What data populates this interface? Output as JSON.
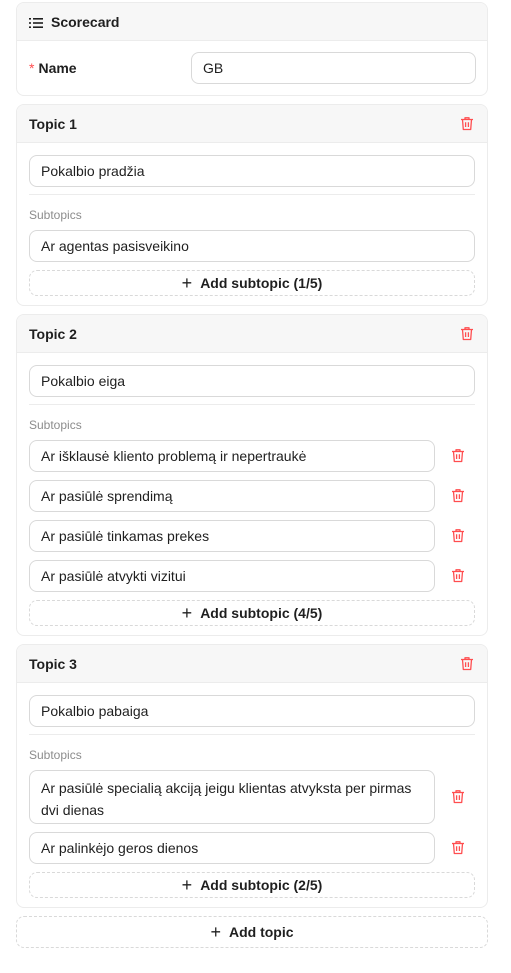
{
  "scorecard": {
    "title": "Scorecard",
    "name_label": "Name",
    "required_mark": "*",
    "name_value": "GB"
  },
  "subtopics_label": "Subtopics",
  "topics": [
    {
      "title": "Topic 1",
      "name": "Pokalbio pradžia",
      "subtopics": [
        "Ar agentas pasisveikino"
      ],
      "add_label": "Add subtopic (1/5)"
    },
    {
      "title": "Topic 2",
      "name": "Pokalbio eiga",
      "subtopics": [
        "Ar išklausė kliento problemą  ir nepertraukė",
        "Ar pasiūlė sprendimą",
        "Ar pasiūlė tinkamas prekes",
        "Ar pasiūlė atvykti vizitui"
      ],
      "add_label": "Add subtopic (4/5)"
    },
    {
      "title": "Topic 3",
      "name": "Pokalbio pabaiga",
      "subtopics": [
        "Ar pasiūlė specialią akciją jeigu klientas atvyksta per pirmas dvi dienas",
        "Ar palinkėjo geros dienos"
      ],
      "add_label": "Add subtopic (2/5)"
    }
  ],
  "add_topic_label": "Add topic",
  "icons": {
    "header": "list-icon",
    "delete": "trash-icon",
    "add": "plus-icon"
  },
  "colors": {
    "danger": "#ff4d4f",
    "border": "#d9d9d9",
    "header_bg": "#f7f7f7",
    "muted_text": "#8c8c8c"
  }
}
